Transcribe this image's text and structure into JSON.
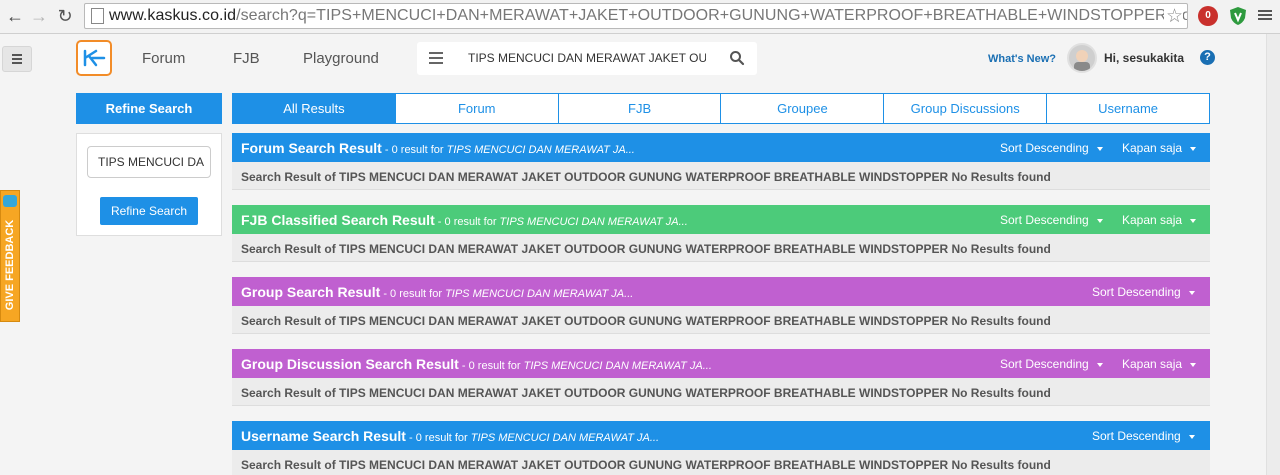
{
  "browser": {
    "url_host": "www.kaskus.co.id",
    "url_path": "/search?q=TIPS+MENCUCI+DAN+MERAWAT+JAKET+OUTDOOR+GUNUNG+WATERPROOF+BREATHABLE+WINDSTOPPER&forumchoic",
    "ext_badge": "0"
  },
  "header": {
    "nav": [
      "Forum",
      "FJB",
      "Playground"
    ],
    "search_query": "TIPS MENCUCI DAN MERAWAT JAKET OUTDO",
    "whats_new": "What's New?",
    "greeting": "Hi, sesukakita",
    "help": "?"
  },
  "sidebar": {
    "refine_title": "Refine Search",
    "refine_input": "TIPS MENCUCI DA",
    "refine_button": "Refine Search",
    "feedback": "GIVE FEEDBACK"
  },
  "tabs": [
    "All Results",
    "Forum",
    "FJB",
    "Groupee",
    "Group Discussions",
    "Username"
  ],
  "sections": [
    {
      "title": "Forum Search Result",
      "meta_prefix": " - 0 result for ",
      "meta_query": "TIPS MENCUCI DAN MERAWAT JA...",
      "sort": "Sort Descending",
      "time": "Kapan saja",
      "body": "Search Result of TIPS MENCUCI DAN MERAWAT JAKET OUTDOOR GUNUNG WATERPROOF BREATHABLE WINDSTOPPER No Results found",
      "color": "#1e90e6"
    },
    {
      "title": "FJB Classified Search Result",
      "meta_prefix": " - 0 result for ",
      "meta_query": "TIPS MENCUCI DAN MERAWAT JA...",
      "sort": "Sort Descending",
      "time": "Kapan saja",
      "body": "Search Result of TIPS MENCUCI DAN MERAWAT JAKET OUTDOOR GUNUNG WATERPROOF BREATHABLE WINDSTOPPER No Results found",
      "color": "#4ccb7a"
    },
    {
      "title": "Group Search Result",
      "meta_prefix": " - 0 result for ",
      "meta_query": "TIPS MENCUCI DAN MERAWAT JA...",
      "sort": "Sort Descending",
      "body": "Search Result of TIPS MENCUCI DAN MERAWAT JAKET OUTDOOR GUNUNG WATERPROOF BREATHABLE WINDSTOPPER No Results found",
      "color": "#c060d0"
    },
    {
      "title": "Group Discussion Search Result",
      "meta_prefix": " - 0 result for ",
      "meta_query": "TIPS MENCUCI DAN MERAWAT JA...",
      "sort": "Sort Descending",
      "time": "Kapan saja",
      "body": "Search Result of TIPS MENCUCI DAN MERAWAT JAKET OUTDOOR GUNUNG WATERPROOF BREATHABLE WINDSTOPPER No Results found",
      "color": "#c060d0"
    },
    {
      "title": "Username Search Result",
      "meta_prefix": " - 0 result for ",
      "meta_query": "TIPS MENCUCI DAN MERAWAT JA...",
      "sort": "Sort Descending",
      "body": "Search Result of TIPS MENCUCI DAN MERAWAT JAKET OUTDOOR GUNUNG WATERPROOF BREATHABLE WINDSTOPPER No Results found",
      "color": "#1e90e6"
    }
  ]
}
